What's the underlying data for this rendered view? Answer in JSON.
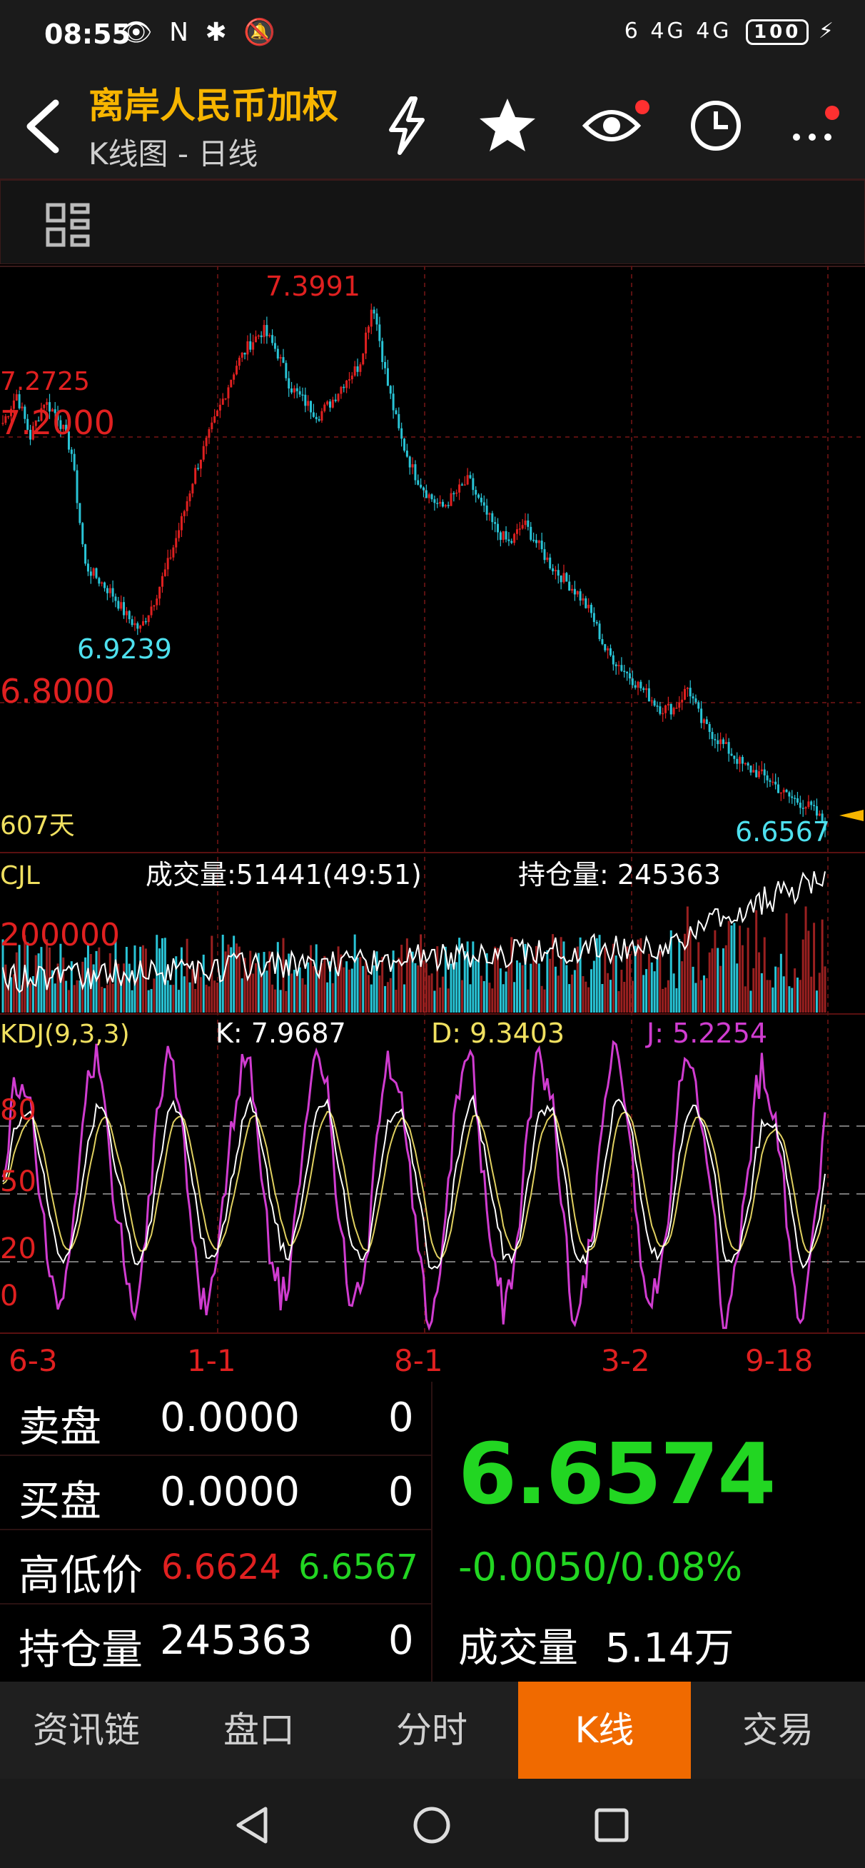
{
  "status": {
    "time": "08:55",
    "icons_left": "👁 N ✱ 🔕",
    "network": "6 4G 4G",
    "battery": "100",
    "charging_icon": "⚡"
  },
  "header": {
    "title": "离岸人民币加权",
    "subtitle": "K线图 - 日线"
  },
  "chart": {
    "price_high_label": "7.3991",
    "price_low_label": "6.9239",
    "price_last_label": "6.6567",
    "grid_left_label_top": "7.2725",
    "grid_label_1": "7.2000",
    "grid_label_2": "6.8000",
    "days_label": "607天",
    "volume_title": "CJL",
    "volume_text": "成交量:51441(49:51)",
    "open_interest_text": "持仓量: 245363",
    "volume_axis_label": "200000",
    "kdj_title": "KDJ(9,3,3)",
    "kdj_k": "K: 7.9687",
    "kdj_d": "D: 9.3403",
    "kdj_j": "J: 5.2254",
    "kdj_axis": [
      "80",
      "50",
      "20",
      "0"
    ],
    "date_labels": [
      "6-3",
      "1-1",
      "8-1",
      "3-2",
      "9-18"
    ]
  },
  "chart_data": {
    "type": "line",
    "title": "",
    "series": [
      {
        "name": "",
        "values": [
          7.22,
          7.26,
          7.2,
          7.25,
          7.23,
          7.18,
          7.02,
          7.0,
          6.98,
          6.95,
          6.93,
          6.97,
          7.02,
          7.08,
          7.15,
          7.2,
          7.25,
          7.3,
          7.33,
          7.35,
          7.32,
          7.27,
          7.25,
          7.23,
          7.25,
          7.28,
          7.3,
          7.39,
          7.28,
          7.2,
          7.15,
          7.12,
          7.1,
          7.12,
          7.14,
          7.1,
          7.07,
          7.05,
          7.08,
          7.05,
          7.02,
          7.0,
          6.98,
          6.95,
          6.9,
          6.88,
          6.86,
          6.84,
          6.82,
          6.82,
          6.85,
          6.8,
          6.78,
          6.76,
          6.74,
          6.73,
          6.72,
          6.7,
          6.69,
          6.68,
          6.6567
        ]
      }
    ],
    "ylim": [
      6.64,
      7.42
    ],
    "colors": {
      "up": "#e02020",
      "down": "#29c4d6",
      "k": "#ffffff",
      "d": "#e0d060",
      "j": "#d03cd0"
    }
  },
  "orderbook": {
    "ask_label": "卖盘",
    "ask_price": "0.0000",
    "ask_vol": "0",
    "bid_label": "买盘",
    "bid_price": "0.0000",
    "bid_vol": "0",
    "hl_label": "高低价",
    "high": "6.6624",
    "low": "6.6567",
    "oi_label": "持仓量",
    "oi_value": "245363",
    "oi_change": "0",
    "price": "6.6574",
    "change": "-0.0050/0.08%",
    "volume_label": "成交量",
    "volume_value": "5.14万"
  },
  "tabs": [
    "资讯链",
    "盘口",
    "分时",
    "K线",
    "交易"
  ]
}
